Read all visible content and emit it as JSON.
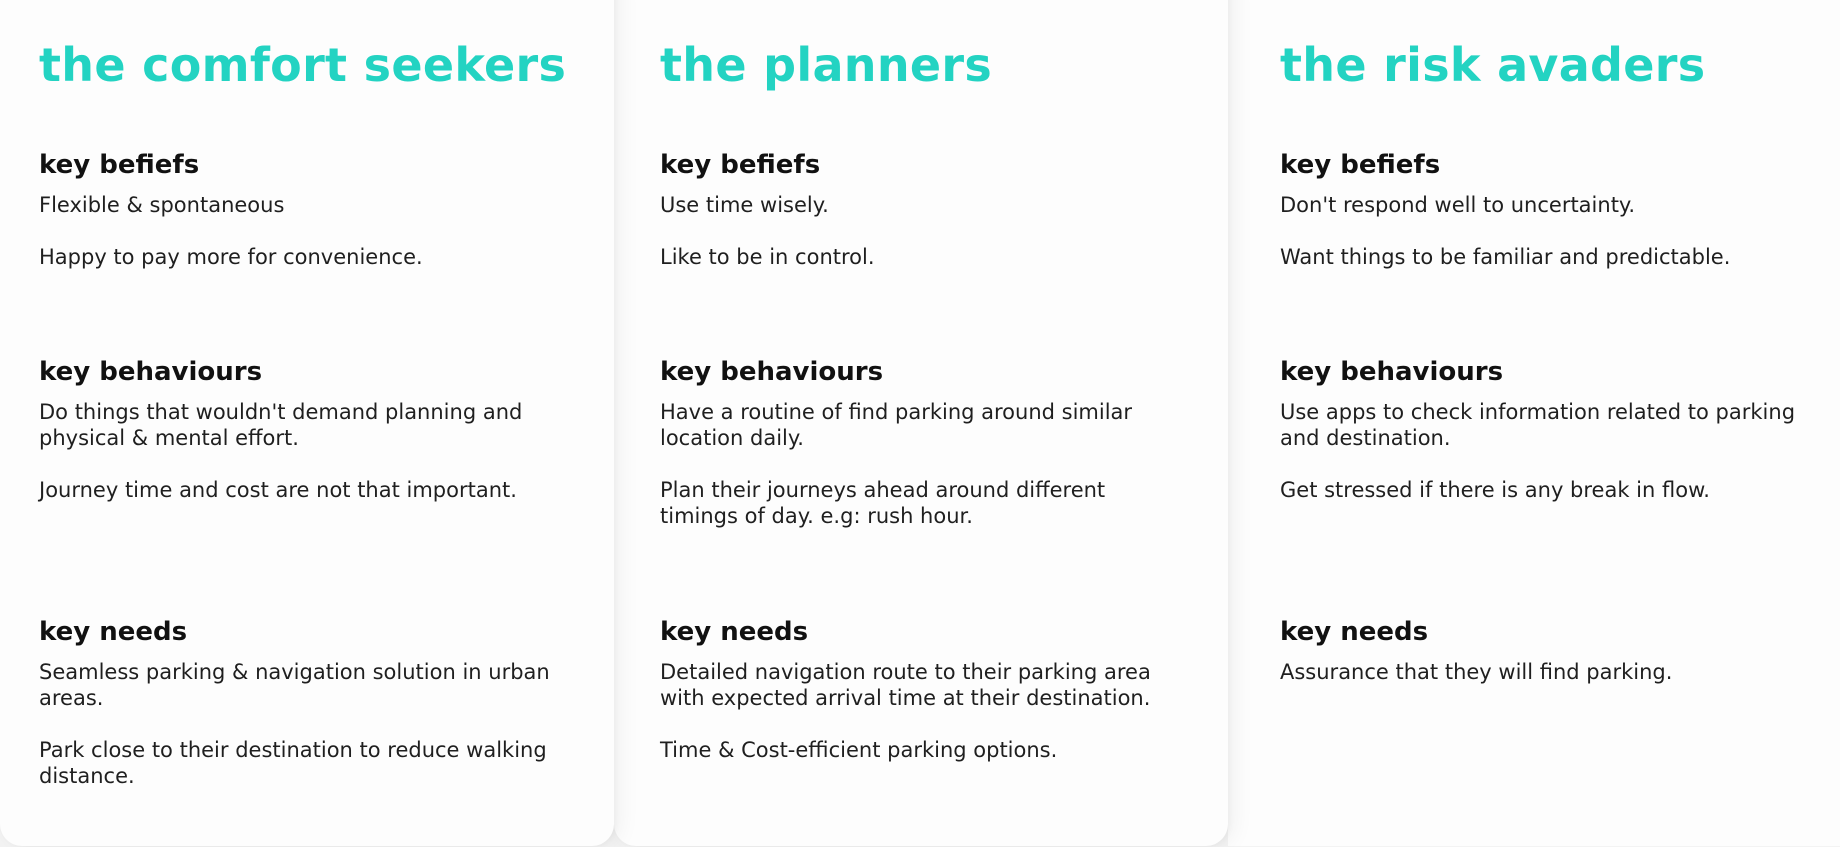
{
  "personas": [
    {
      "title": "the comfort seekers",
      "beliefs": {
        "heading": "key befiefs",
        "items": [
          "Flexible & spontaneous",
          "Happy to pay more for convenience."
        ]
      },
      "behaviours": {
        "heading": "key behaviours",
        "items": [
          "Do things that wouldn't demand planning and physical & mental effort.",
          "Journey time and cost are not that important."
        ]
      },
      "needs": {
        "heading": "key needs",
        "items": [
          "Seamless parking & navigation solution in urban areas.",
          "Park close to their destination to reduce walking distance."
        ]
      }
    },
    {
      "title": "the planners",
      "beliefs": {
        "heading": "key befiefs",
        "items": [
          "Use time wisely.",
          "Like to be in control."
        ]
      },
      "behaviours": {
        "heading": "key behaviours",
        "items": [
          "Have a routine of find parking around similar location daily.",
          "Plan their journeys ahead around different timings of day. e.g: rush hour."
        ]
      },
      "needs": {
        "heading": "key needs",
        "items": [
          "Detailed navigation route to their parking area with expected arrival time at their destination.",
          "Time & Cost-efficient parking options."
        ]
      }
    },
    {
      "title": "the risk avaders",
      "beliefs": {
        "heading": "key befiefs",
        "items": [
          "Don't respond well to uncertainty.",
          "Want things to be familiar and predictable."
        ]
      },
      "behaviours": {
        "heading": "key behaviours",
        "items": [
          "Use apps to check information related to parking and destination.",
          "Get stressed if there is any break in flow."
        ]
      },
      "needs": {
        "heading": "key needs",
        "items": [
          "Assurance that they will find parking."
        ]
      }
    }
  ],
  "colors": {
    "accent": "#23d3c2",
    "text": "#161616",
    "card": "#fdfdfd",
    "background": "#f3f3f3"
  }
}
